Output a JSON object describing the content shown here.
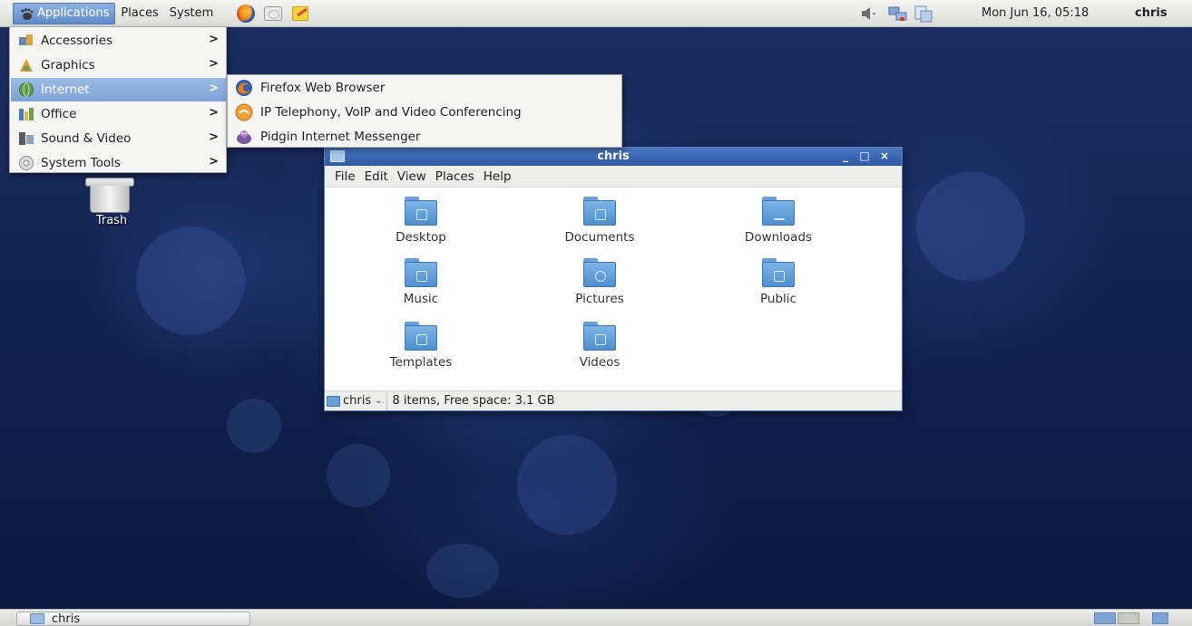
{
  "top_panel": {
    "applications_label": "Applications",
    "places_label": "Places",
    "system_label": "System",
    "clock": "Mon Jun 16, 05:18",
    "user": "chris"
  },
  "apps_menu": {
    "items": [
      {
        "label": "Accessories",
        "icon": "accessories-icon"
      },
      {
        "label": "Graphics",
        "icon": "graphics-icon"
      },
      {
        "label": "Internet",
        "icon": "internet-icon",
        "active": true
      },
      {
        "label": "Office",
        "icon": "office-icon"
      },
      {
        "label": "Sound & Video",
        "icon": "sound-video-icon"
      },
      {
        "label": "System Tools",
        "icon": "system-tools-icon"
      }
    ],
    "submenu_arrow": ">"
  },
  "internet_submenu": {
    "items": [
      {
        "label": "Firefox Web Browser",
        "icon": "firefox-icon"
      },
      {
        "label": "IP Telephony, VoIP and Video Conferencing",
        "icon": "ekiga-icon"
      },
      {
        "label": "Pidgin Internet Messenger",
        "icon": "pidgin-icon"
      }
    ]
  },
  "desktop": {
    "trash_label": "Trash"
  },
  "file_manager": {
    "title": "chris",
    "menu": [
      "File",
      "Edit",
      "View",
      "Places",
      "Help"
    ],
    "folders": [
      {
        "label": "Desktop",
        "icon": "desktop-folder-icon"
      },
      {
        "label": "Documents",
        "icon": "documents-folder-icon"
      },
      {
        "label": "Downloads",
        "icon": "downloads-folder-icon"
      },
      {
        "label": "Music",
        "icon": "music-folder-icon"
      },
      {
        "label": "Pictures",
        "icon": "pictures-folder-icon"
      },
      {
        "label": "Public",
        "icon": "public-folder-icon"
      },
      {
        "label": "Templates",
        "icon": "templates-folder-icon"
      },
      {
        "label": "Videos",
        "icon": "videos-folder-icon"
      }
    ],
    "path": "chris",
    "status": "8 items, Free space: 3.1 GB",
    "window_buttons": {
      "minimize": "_",
      "maximize": "□",
      "close": "×"
    }
  },
  "bottom_panel": {
    "task_label": "chris"
  },
  "colors": {
    "highlight": "#7ea3d6",
    "titlebar": "#2f5aa6",
    "folder": "#4e8fcf",
    "desktop_bg": "#132352"
  }
}
